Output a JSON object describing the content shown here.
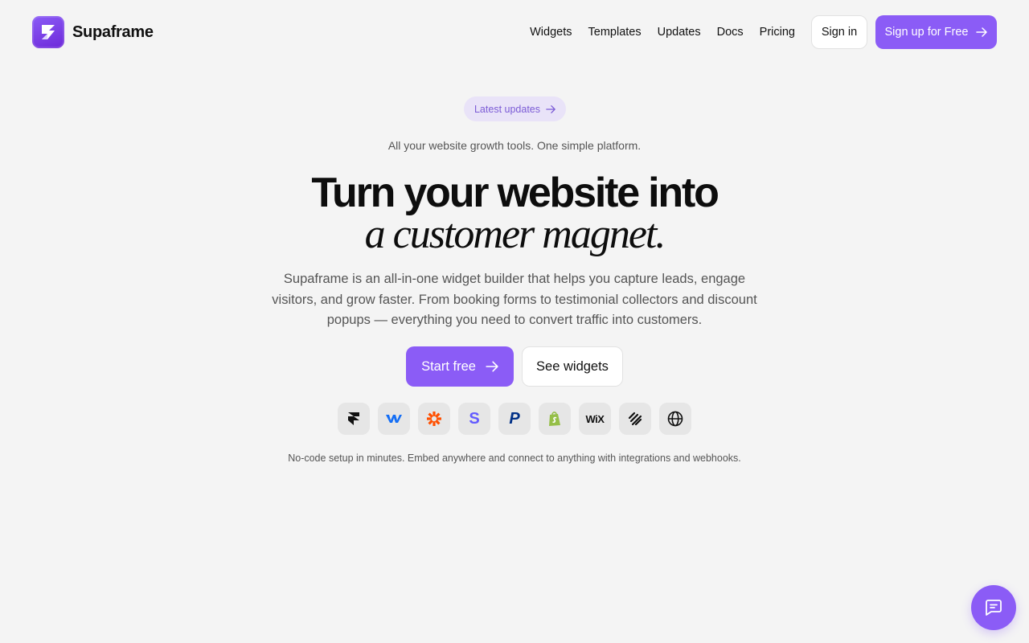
{
  "header": {
    "brand_name": "Supaframe",
    "nav": [
      "Widgets",
      "Templates",
      "Updates",
      "Docs",
      "Pricing"
    ],
    "signin_label": "Sign in",
    "signup_label": "Sign up for Free"
  },
  "hero": {
    "pill_label": "Latest updates",
    "tagline": "All your website growth tools. One simple platform.",
    "headline_line1": "Turn your website into",
    "headline_line2": "a customer magnet.",
    "description": "Supaframe is an all-in-one widget builder that helps you capture leads, engage visitors, and grow faster. From booking forms to testimonial collectors and discount popups — everything you need to convert traffic into customers.",
    "start_label": "Start free",
    "widgets_label": "See widgets",
    "footnote": "No-code setup in minutes. Embed anywhere and connect to anything with integrations and webhooks."
  },
  "integrations": [
    {
      "name": "framer-icon",
      "text": ""
    },
    {
      "name": "webflow-icon",
      "text": ""
    },
    {
      "name": "zapier-icon",
      "text": ""
    },
    {
      "name": "stripe-icon",
      "text": "S"
    },
    {
      "name": "paypal-icon",
      "text": "P"
    },
    {
      "name": "shopify-icon",
      "text": ""
    },
    {
      "name": "wix-icon",
      "text": "WiX"
    },
    {
      "name": "squarespace-icon",
      "text": ""
    },
    {
      "name": "globe-icon",
      "text": ""
    }
  ],
  "colors": {
    "accent": "#8b5cf6",
    "background": "#f4f4f4",
    "pill_bg": "#e9e3f8",
    "pill_text": "#7c5cd6"
  },
  "chat": {
    "icon": "chat-bubble-icon"
  }
}
